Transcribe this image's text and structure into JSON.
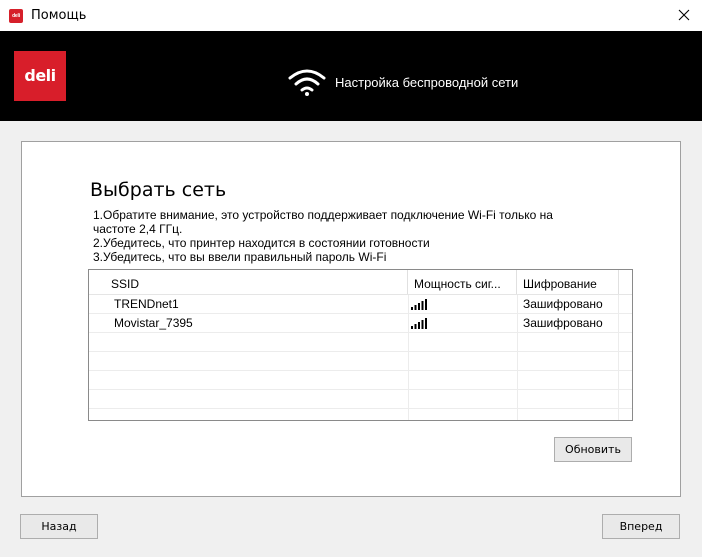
{
  "window": {
    "title": "Помощь",
    "app_icon_text": "deli"
  },
  "banner": {
    "logo_text": "deli",
    "title": "Настройка беспроводной сети",
    "logo_color": "#d81e2a"
  },
  "main": {
    "section_title": "Выбрать сеть",
    "notes": [
      "1.Обратите внимание, это устройство поддерживает подключение Wi-Fi только на",
      "частоте 2,4 ГГц.",
      "2.Убедитесь, что принтер находится в состоянии готовности",
      "3.Убедитесь, что вы ввели правильный пароль Wi-Fi"
    ]
  },
  "table": {
    "columns": [
      "SSID",
      "Мощность сиг...",
      "Шифрование"
    ],
    "rows": [
      {
        "ssid": "TRENDnet1",
        "signal_level": 4,
        "encryption": "Зашифровано"
      },
      {
        "ssid": "Movistar_7395",
        "signal_level": 4,
        "encryption": "Зашифровано"
      }
    ]
  },
  "buttons": {
    "refresh": "Обновить",
    "back": "Назад",
    "next": "Вперед"
  }
}
